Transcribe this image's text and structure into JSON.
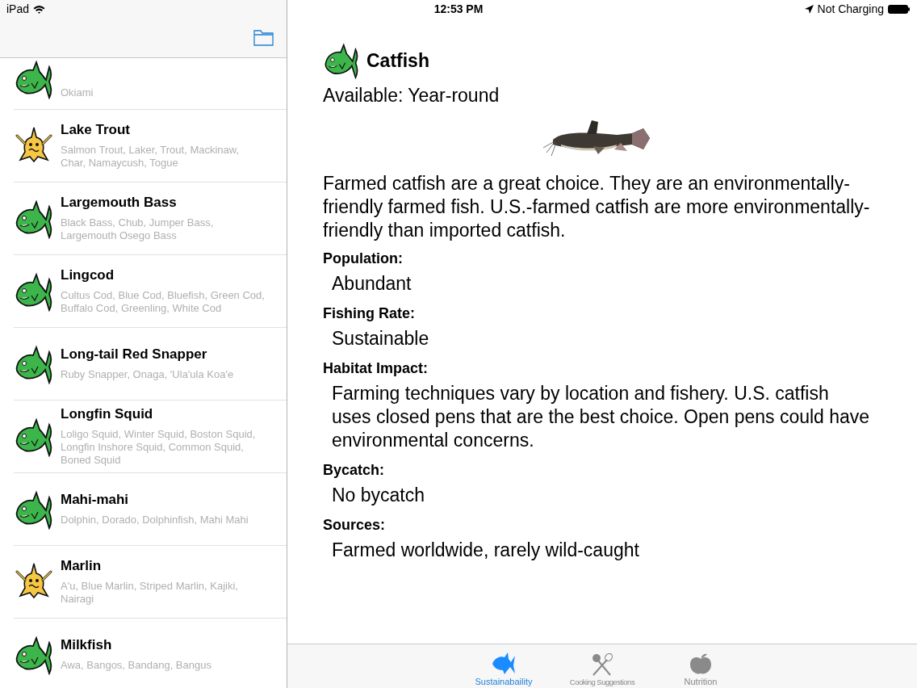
{
  "status_bar": {
    "device": "iPad",
    "time": "12:53 PM",
    "battery_text": "Not Charging"
  },
  "fish_list": [
    {
      "aliases": "Okiami",
      "kind": "best"
    },
    {
      "name": "Lake Trout",
      "aliases": "Salmon Trout, Laker, Trout, Mackinaw, Char, Namaycush, Togue",
      "kind": "good"
    },
    {
      "name": "Largemouth Bass",
      "aliases": "Black Bass, Chub, Jumper Bass, Largemouth Osego Bass",
      "kind": "best"
    },
    {
      "name": "Lingcod",
      "aliases": "Cultus Cod, Blue Cod, Bluefish, Green Cod, Buffalo Cod, Greenling, White Cod",
      "kind": "best"
    },
    {
      "name": "Long-tail Red Snapper",
      "aliases": "Ruby Snapper, Onaga, 'Ula'ula Koa'e",
      "kind": "best"
    },
    {
      "name": "Longfin Squid",
      "aliases": "Loligo Squid, Winter Squid, Boston Squid, Longfin Inshore Squid, Common Squid, Boned Squid",
      "kind": "best"
    },
    {
      "name": "Mahi-mahi",
      "aliases": "Dolphin, Dorado, Dolphinfish, Mahi Mahi",
      "kind": "best"
    },
    {
      "name": "Marlin",
      "aliases": "A'u, Blue Marlin, Striped Marlin, Kajiki, Nairagi",
      "kind": "good"
    },
    {
      "name": "Milkfish",
      "aliases": "Awa, Bangos, Bandang, Bangus",
      "kind": "best"
    }
  ],
  "detail": {
    "title": "Catfish",
    "kind": "best",
    "available": "Available: Year-round",
    "description": "Farmed catfish are a great choice. They are an environmentally-friendly farmed fish. U.S.-farmed catfish are more environmentally-friendly than imported catfish.",
    "sections": [
      {
        "label": "Population:",
        "value": "Abundant"
      },
      {
        "label": "Fishing Rate:",
        "value": "Sustainable"
      },
      {
        "label": "Habitat Impact:",
        "value": "Farming techniques vary by location and fishery. U.S. catfish uses closed pens that are the best choice. Open pens could have environmental concerns."
      },
      {
        "label": "Bycatch:",
        "value": "No bycatch"
      },
      {
        "label": "Sources:",
        "value": "Farmed worldwide, rarely wild-caught"
      }
    ]
  },
  "tabs": [
    {
      "label": "Sustainabaility",
      "selected": true
    },
    {
      "label": "Cooking Suggestions",
      "selected": false
    },
    {
      "label": "Nutrition",
      "selected": false
    }
  ]
}
